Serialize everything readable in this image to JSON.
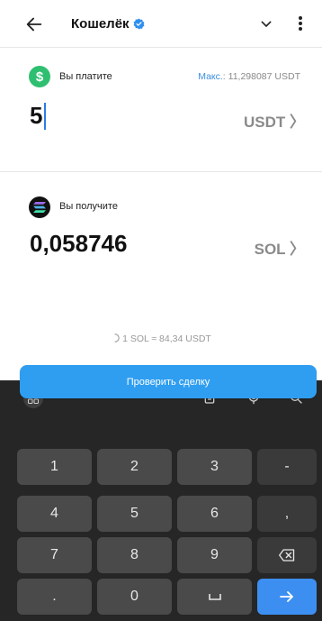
{
  "header": {
    "title": "Кошелёк",
    "back_icon": "arrow-left-icon",
    "verified_icon": "verified-badge-icon",
    "dropdown_icon": "chevron-down-icon",
    "menu_icon": "more-vert-icon"
  },
  "pay": {
    "label": "Вы платите",
    "max_prefix": "Макс.",
    "max_value": ": 11,298087 USDT",
    "amount": "5",
    "currency": "USDT 〉",
    "icon_symbol": "$",
    "icon_color": "#2fbf71"
  },
  "receive": {
    "label": "Вы получите",
    "amount": "0,058746",
    "currency": "SOL 〉"
  },
  "rate": {
    "text": "1 SOL ≈ 84,34 USDT"
  },
  "action_button": {
    "label": "Проверить сделку",
    "color": "#2f9ef0"
  },
  "keyboard": {
    "top_icons": [
      "grid-apps-icon",
      "clipboard-icon",
      "microphone-icon",
      "search-icon"
    ],
    "rows": [
      [
        "1",
        "2",
        "3",
        "-"
      ],
      [
        "4",
        "5",
        "6",
        ","
      ],
      [
        "7",
        "8",
        "9",
        "backspace-icon"
      ],
      [
        ".",
        "0",
        "space-icon",
        "enter-arrow-icon"
      ]
    ]
  }
}
